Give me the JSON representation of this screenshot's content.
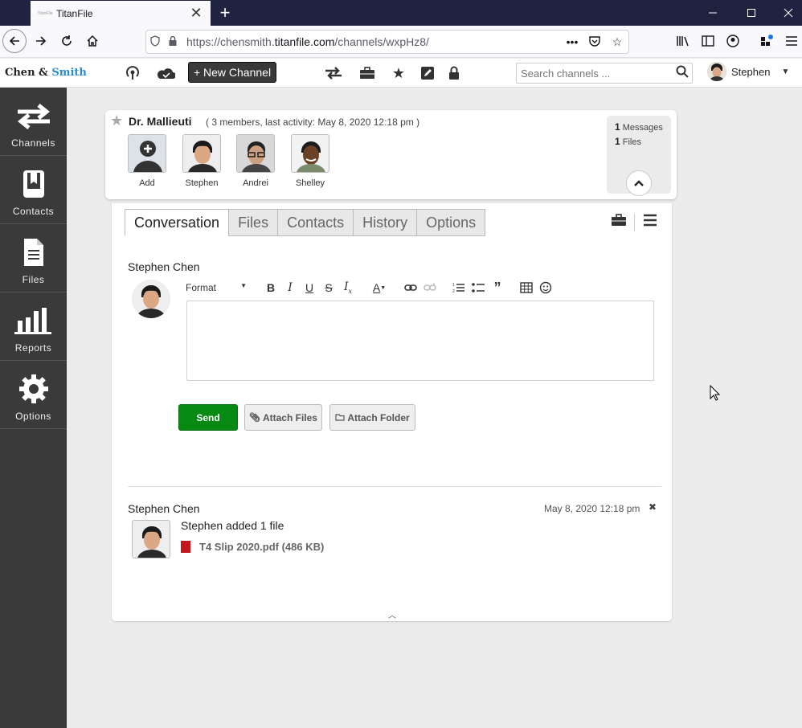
{
  "browser": {
    "tab_title": "TitanFile",
    "tab_favicon_text": "TitanFile",
    "url_prefix": "https://chensmith.",
    "url_domain": "titanfile.com",
    "url_path": "/channels/wxpHz8/"
  },
  "header": {
    "brand_part1": "Chen & ",
    "brand_part2": "Smith",
    "new_channel_label": "+ New Channel",
    "search_placeholder": "Search channels ...",
    "user_name": "Stephen"
  },
  "sidebar": {
    "items": [
      {
        "label": "Channels",
        "icon": "arrows-icon"
      },
      {
        "label": "Contacts",
        "icon": "address-book-icon"
      },
      {
        "label": "Files",
        "icon": "file-icon"
      },
      {
        "label": "Reports",
        "icon": "bar-chart-icon"
      },
      {
        "label": "Options",
        "icon": "gear-icon"
      }
    ]
  },
  "channel": {
    "name": "Dr. Mallieuti",
    "meta": "( 3 members, last activity: May 8, 2020 12:18 pm )",
    "members": [
      {
        "label": "Add"
      },
      {
        "label": "Stephen"
      },
      {
        "label": "Andrei"
      },
      {
        "label": "Shelley"
      }
    ],
    "stats": {
      "messages_count": "1",
      "messages_label": "Messages",
      "files_count": "1",
      "files_label": "Files"
    }
  },
  "tabs": [
    {
      "label": "Conversation",
      "active": true
    },
    {
      "label": "Files",
      "active": false
    },
    {
      "label": "Contacts",
      "active": false
    },
    {
      "label": "History",
      "active": false
    },
    {
      "label": "Options",
      "active": false
    }
  ],
  "composer": {
    "author": "Stephen Chen",
    "format_label": "Format",
    "send_label": "Send",
    "attach_files_label": "Attach Files",
    "attach_folder_label": "Attach Folder"
  },
  "message": {
    "author": "Stephen Chen",
    "date": "May 8, 2020 12:18 pm",
    "text": "Stephen added 1 file",
    "file": "T4 Slip 2020.pdf (486 KB)"
  },
  "colors": {
    "accent_blue": "#2a8bd0",
    "send_green": "#078a13",
    "sidebar_bg": "#3a3a3a",
    "pdf_red": "#c4161c"
  }
}
